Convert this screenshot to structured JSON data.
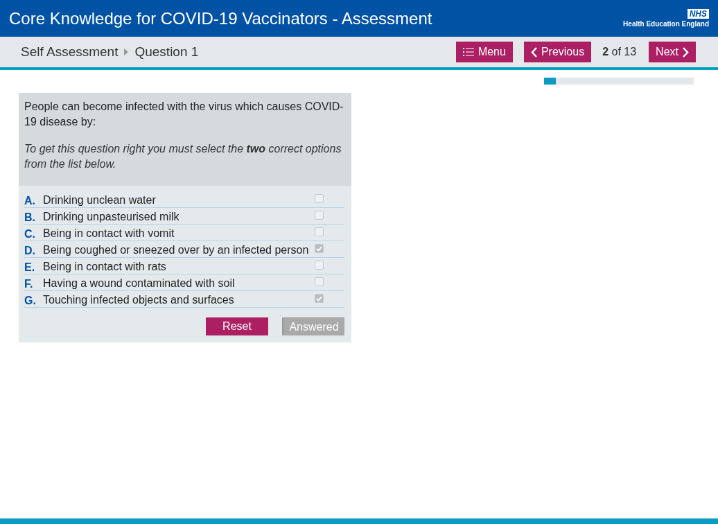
{
  "header": {
    "title": "Core Knowledge for COVID-19 Vaccinators - Assessment",
    "logo_badge": "NHS",
    "logo_text": "Health Education England"
  },
  "nav": {
    "breadcrumb": [
      "Self Assessment",
      "Question 1"
    ],
    "menu_button": "Menu",
    "previous_button": "Previous",
    "page_counter": "**2** of 13",
    "next_button": "Next",
    "progress": {
      "level": 0.08
    }
  },
  "question": {
    "prompt": "People can become infected with the virus which causes COVID-19 disease by:",
    "instruction": "To get this question right you must select the **two** correct options from the list below.",
    "options": [
      {
        "letter": "A.",
        "text": "Drinking unclean water",
        "checked": false
      },
      {
        "letter": "B.",
        "text": "Drinking unpasteurised milk",
        "checked": false
      },
      {
        "letter": "C.",
        "text": "Being in contact with vomit",
        "checked": false
      },
      {
        "letter": "D.",
        "text": "Being coughed or sneezed over by an infected person",
        "checked": true
      },
      {
        "letter": "E.",
        "text": "Being in contact with rats",
        "checked": false
      },
      {
        "letter": "F.",
        "text": "Having a wound contaminated with soil",
        "checked": false
      },
      {
        "letter": "G.",
        "text": "Touching infected objects and surfaces",
        "checked": true
      }
    ],
    "reset_button": "Reset",
    "answered_button": {
      "label": "Answered",
      "disabled": true
    }
  }
}
